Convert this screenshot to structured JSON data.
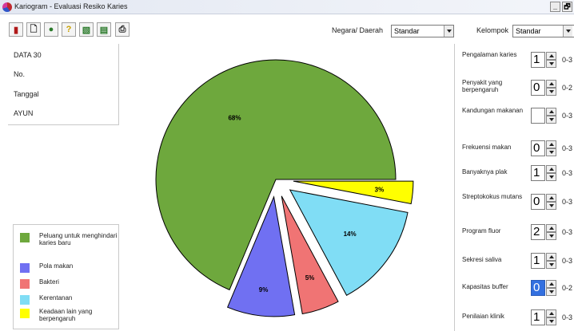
{
  "window": {
    "title": "Kariogram - Evaluasi Resiko Karies",
    "minimize_label": "_",
    "restore_label": "🗗"
  },
  "toolbar": {
    "buttons": [
      {
        "name": "exit-button",
        "icon": "door-icon",
        "glyph": "▮",
        "color": "#b01818"
      },
      {
        "name": "new-button",
        "icon": "new-document-icon",
        "glyph": "🗋",
        "color": "#222"
      },
      {
        "name": "chart-button",
        "icon": "pie-chart-icon",
        "glyph": "●",
        "color": "#2b7a2b"
      },
      {
        "name": "help-button",
        "icon": "question-icon",
        "glyph": "?",
        "color": "#c8a000"
      },
      {
        "name": "open-button",
        "icon": "image-icon",
        "glyph": "▧",
        "color": "#2b7a2b"
      },
      {
        "name": "save-button",
        "icon": "save-icon",
        "glyph": "▤",
        "color": "#2b7a2b"
      },
      {
        "name": "print-button",
        "icon": "printer-icon",
        "glyph": "⎙",
        "color": "#222"
      }
    ],
    "country_label": "Negara/ Daerah",
    "country_value": "Standar",
    "group_label": "Kelompok",
    "group_value": "Standar"
  },
  "info": {
    "data": "DATA 30",
    "no": "No.",
    "tanggal": "Tanggal",
    "name": "AYUN"
  },
  "legend": [
    {
      "label": "Peluang untuk menghindari karies baru",
      "color": "#6ea83d"
    },
    {
      "label": "Pola makan",
      "color": "#7070f2"
    },
    {
      "label": "Bakteri",
      "color": "#f07474"
    },
    {
      "label": "Kerentanan",
      "color": "#80ddf5"
    },
    {
      "label": "Keadaan lain yang berpengaruh",
      "color": "#ffff00"
    }
  ],
  "chart_data": {
    "type": "pie",
    "start_angle": "right, counter-clockwise",
    "exploded": "all but largest slice",
    "slices": [
      {
        "name": "Peluang untuk menghindari karies baru",
        "value": 68,
        "label": "68%",
        "color": "#6ea83d"
      },
      {
        "name": "Pola makan",
        "value": 9,
        "label": "9%",
        "color": "#7070f2"
      },
      {
        "name": "Bakteri",
        "value": 5,
        "label": "5%",
        "color": "#f07474"
      },
      {
        "name": "Kerentanan",
        "value": 14,
        "label": "14%",
        "color": "#80ddf5"
      },
      {
        "name": "Keadaan lain yang berpengaruh",
        "value": 3,
        "label": "3%",
        "color": "#ffff00"
      }
    ]
  },
  "params": [
    {
      "label": "Pengalaman karies",
      "value": "1",
      "range": "0-3"
    },
    {
      "label": "Penyakit yang berpengaruh",
      "value": "0",
      "range": "0-2"
    },
    {
      "label": "Kandungan makanan",
      "value": "",
      "range": "0-3"
    },
    {
      "label": "Frekuensi makan",
      "value": "0",
      "range": "0-3"
    },
    {
      "label": "Banyaknya plak",
      "value": "1",
      "range": "0-3"
    },
    {
      "label": "Streptokokus mutans",
      "value": "0",
      "range": "0-3"
    },
    {
      "label": "Program fluor",
      "value": "2",
      "range": "0-3"
    },
    {
      "label": "Sekresi saliva",
      "value": "1",
      "range": "0-3"
    },
    {
      "label": "Kapasitas buffer",
      "value": "0",
      "range": "0-2",
      "selected": true
    },
    {
      "label": "Penilaian klinik",
      "value": "1",
      "range": "0-3"
    }
  ]
}
